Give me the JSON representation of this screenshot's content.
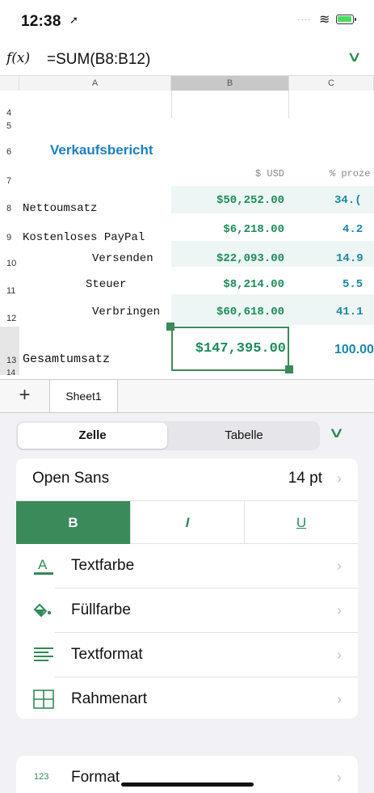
{
  "status": {
    "time": "12:38",
    "loc_glyph": "➚",
    "dots": "....",
    "wifi_glyph": "≋"
  },
  "formula_bar": {
    "fx": "f(x)",
    "formula": "=SUM(B8:B12)",
    "chevron": "∨"
  },
  "columns": [
    "A",
    "B",
    "C"
  ],
  "rows": {
    "r4": "4",
    "r5": "5",
    "r6": "6",
    "r7": "7",
    "r8": "8",
    "r9": "9",
    "r10": "10",
    "r11": "11",
    "r12": "12",
    "r13": "13",
    "r14": "14"
  },
  "sheet": {
    "title": "Verkaufsbericht",
    "col_b_header": "$ USD",
    "col_c_header": "% proze",
    "labels": [
      "Nettoumsatz",
      "Kostenloses PayPal",
      "Versenden",
      "Steuer",
      "Verbringen"
    ],
    "values": [
      "$50,252.00",
      "$6,218.00",
      "$22,093.00",
      "$8,214.00",
      "$60,618.00"
    ],
    "percents": [
      "34.(",
      "4.2",
      "14.9",
      "5.5",
      "41.1"
    ],
    "total_label": "Gesamtumsatz",
    "total_value": "$147,395.00",
    "total_pct": "100.00"
  },
  "tabs": {
    "add": "+",
    "sheet1": "Sheet1"
  },
  "panel": {
    "seg_cell": "Zelle",
    "seg_table": "Tabelle",
    "collapse": "∨",
    "font_name": "Open Sans",
    "font_size": "14 pt",
    "bold": "B",
    "italic": "I",
    "underline": "U",
    "text_color": "Textfarbe",
    "fill_color": "Füllfarbe",
    "text_format": "Textformat",
    "border_style": "Rahmenart",
    "format_num": "123",
    "format": "Format",
    "chevron": "›"
  },
  "colors": {
    "accent": "#3a8a5a",
    "value": "#1e8b5a",
    "percent": "#1d87a6",
    "title": "#1d7fbf"
  }
}
